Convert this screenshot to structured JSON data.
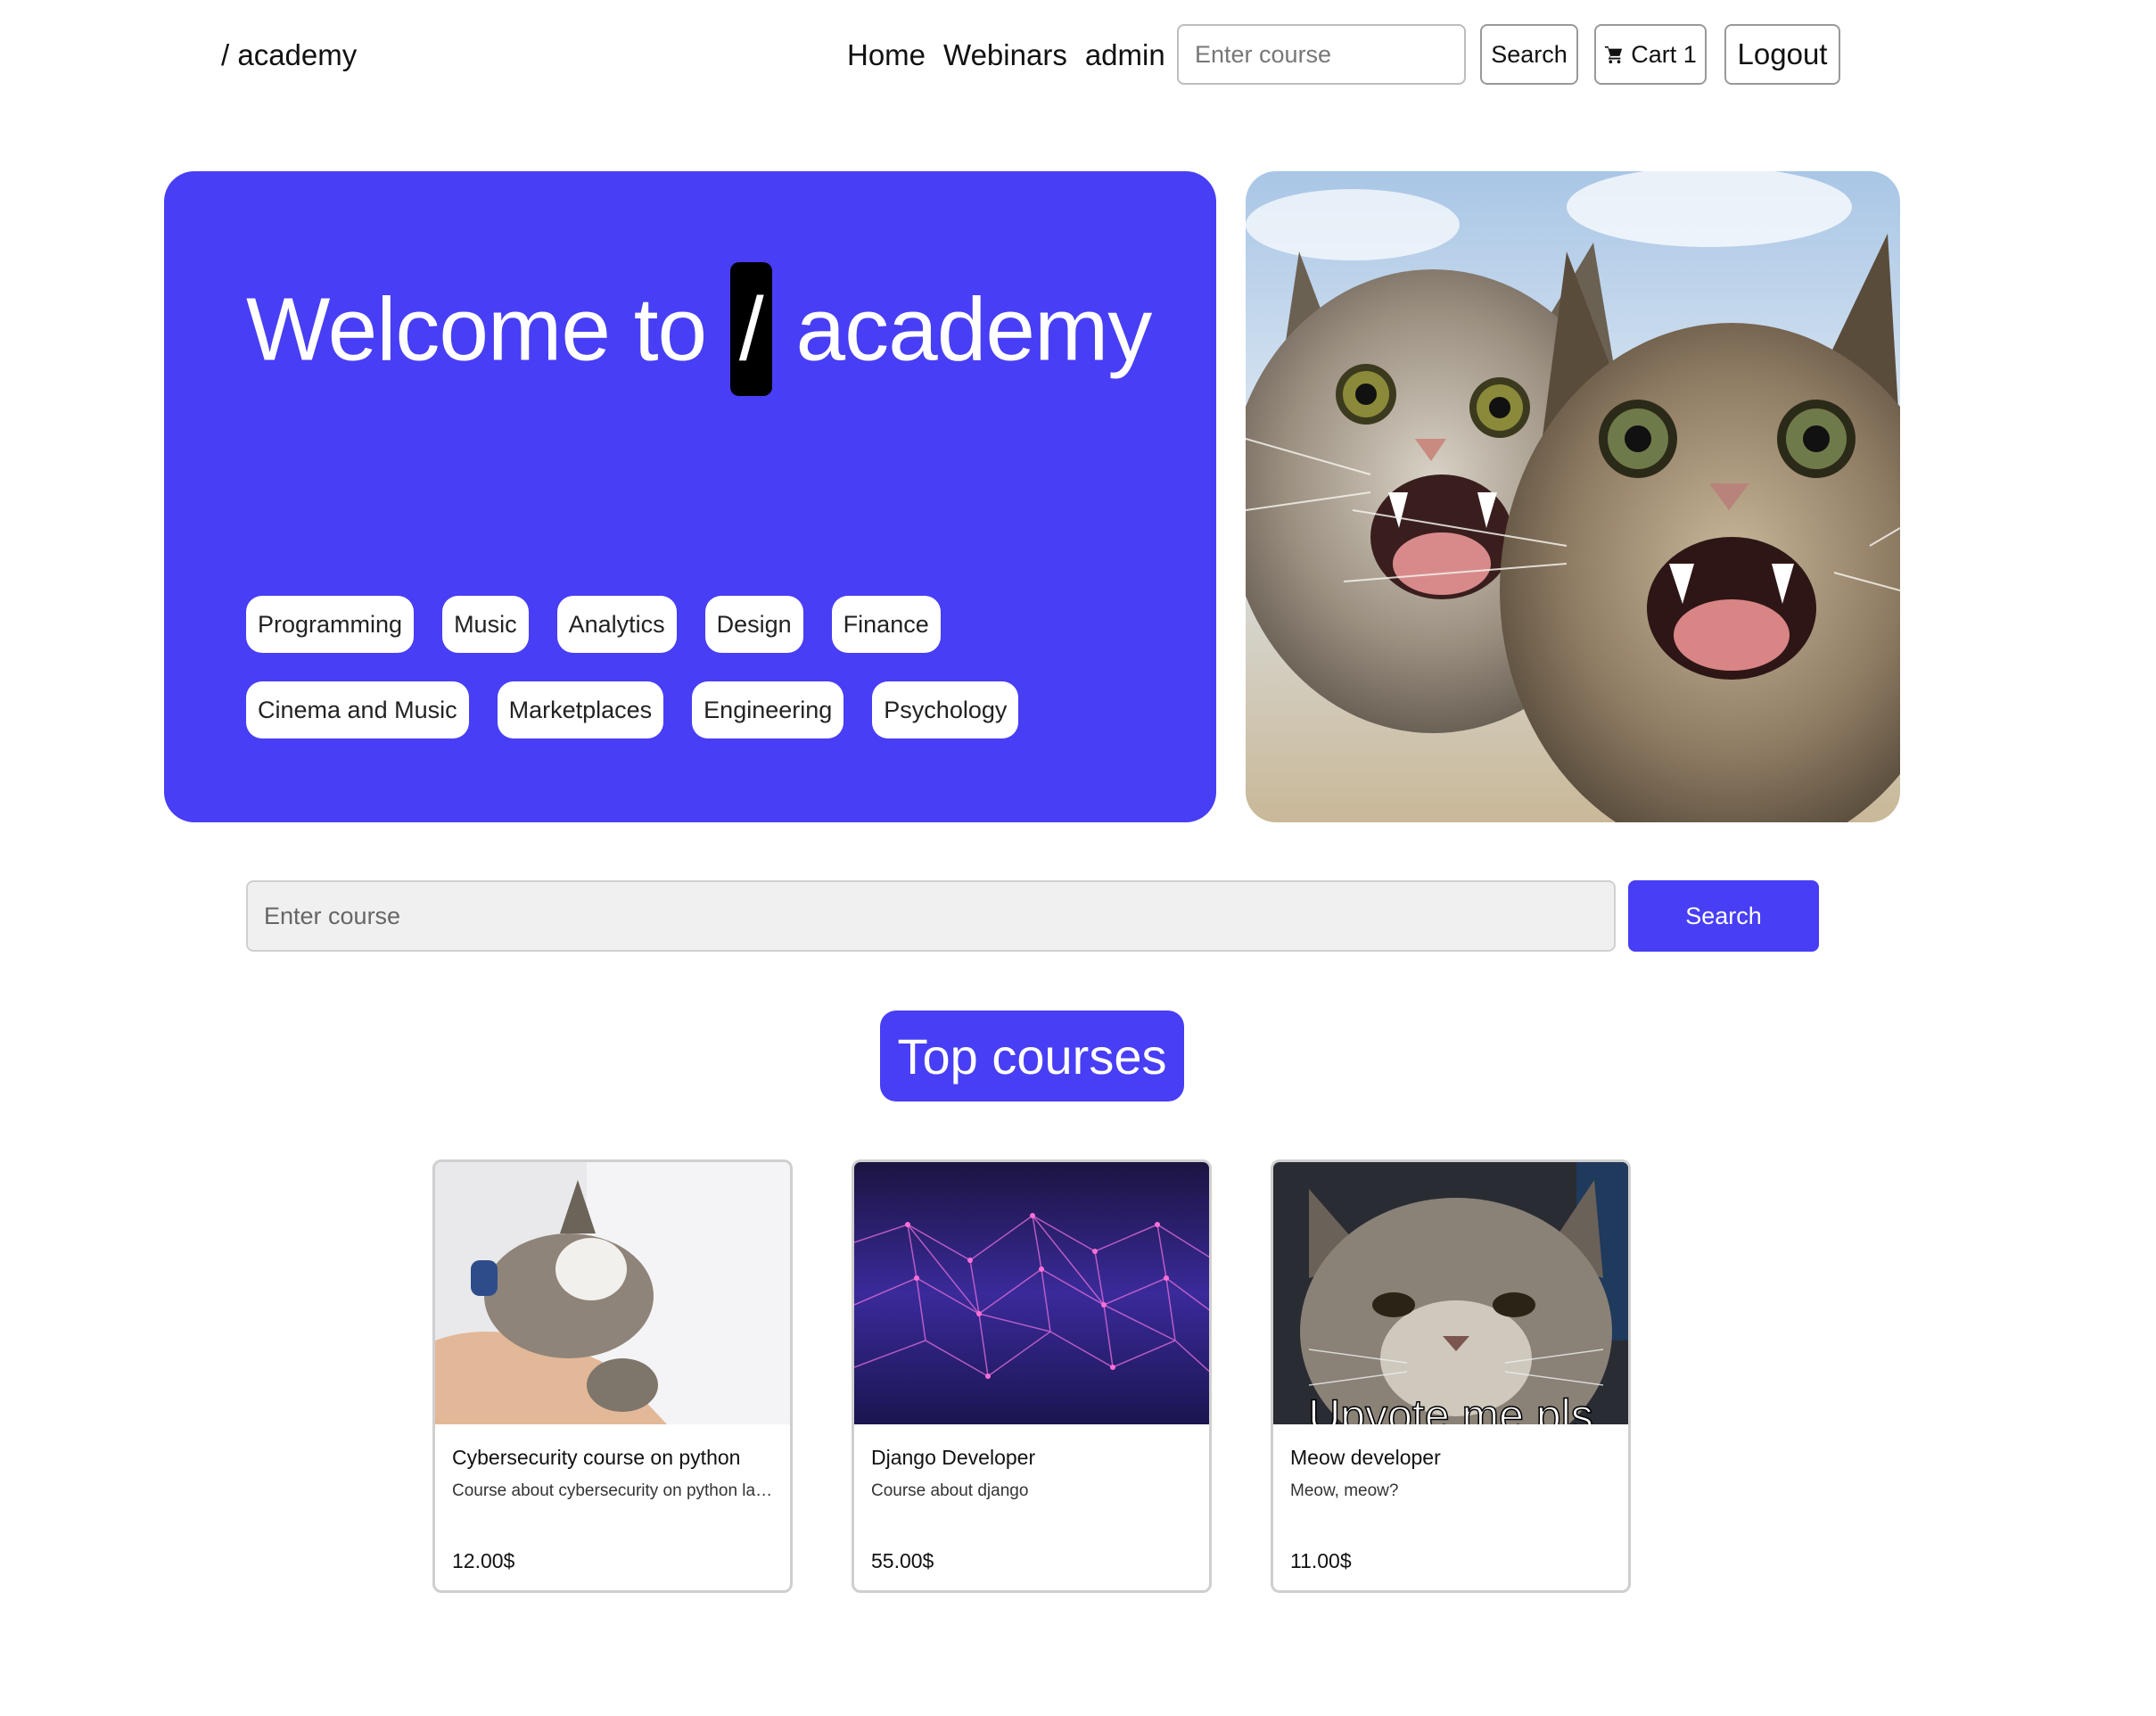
{
  "navbar": {
    "brand": "/ academy",
    "links": [
      "Home",
      "Webinars",
      "admin"
    ],
    "search_placeholder": "Enter course",
    "search_label": "Search",
    "cart_label": "Cart 1",
    "logout_label": "Logout"
  },
  "hero": {
    "title_before": "Welcome to ",
    "title_slash": "/",
    "title_after": " academy",
    "tags_row1": [
      "Programming",
      "Music",
      "Analytics",
      "Design",
      "Finance"
    ],
    "tags_row2": [
      "Cinema and Music",
      "Marketplaces",
      "Engineering",
      "Psychology"
    ]
  },
  "main_search": {
    "placeholder": "Enter course",
    "button_label": "Search"
  },
  "top_courses": {
    "heading": "Top courses",
    "courses": [
      {
        "title": "Cybersecurity course on python",
        "description": "Course about cybersecurity on python language",
        "price": "12.00$"
      },
      {
        "title": "Django Developer",
        "description": "Course about django",
        "price": "55.00$"
      },
      {
        "title": "Meow developer",
        "description": "Meow, meow?",
        "price": "11.00$",
        "image_caption": "Upvote me pls"
      }
    ]
  },
  "colors": {
    "accent": "#483ef5",
    "slash_bg": "#000000"
  }
}
